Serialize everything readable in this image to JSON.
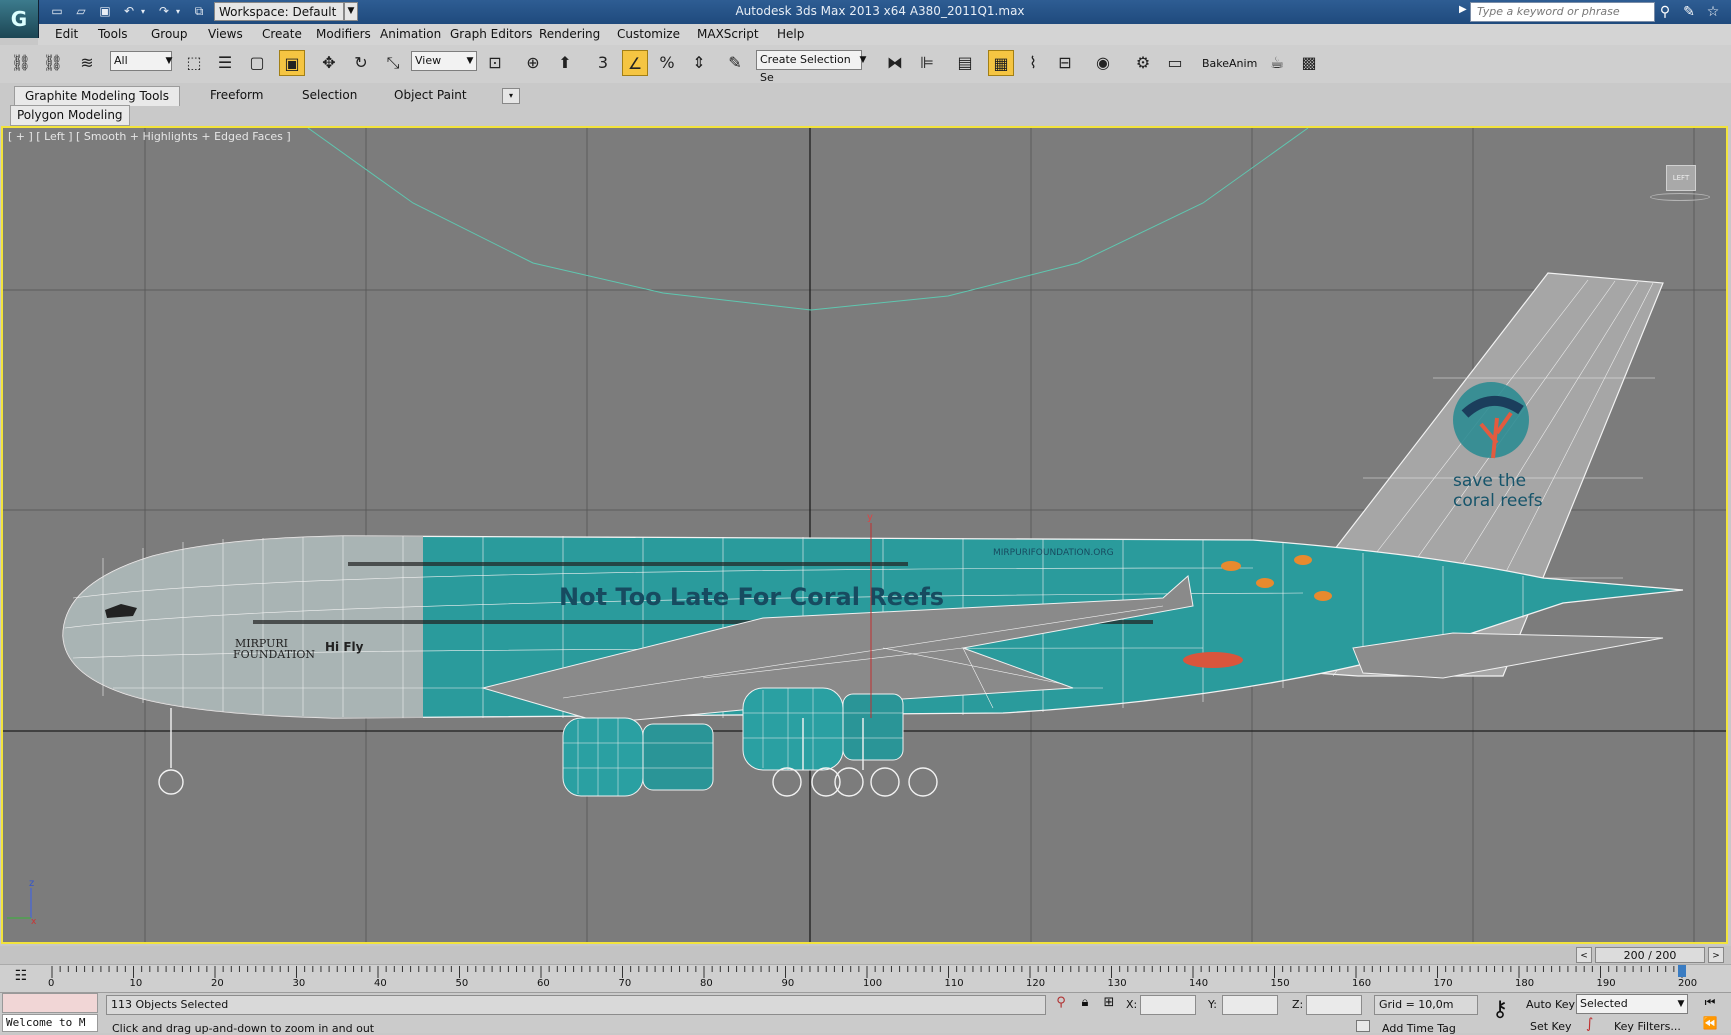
{
  "titlebar": {
    "app_title": "Autodesk 3ds Max  2013 x64     A380_2011Q1.max",
    "workspace": "Workspace: Default",
    "search_placeholder": "Type a keyword or phrase"
  },
  "menu": [
    "Edit",
    "Tools",
    "Group",
    "Views",
    "Create",
    "Modifiers",
    "Animation",
    "Graph Editors",
    "Rendering",
    "Customize",
    "MAXScript",
    "Help"
  ],
  "toolbar": {
    "filter_value": "All",
    "refcoord_value": "View",
    "selection_set_placeholder": "Create Selection Se",
    "bakeanim_label": "BakeAnim"
  },
  "ribbon": {
    "tabs": [
      "Graphite Modeling Tools",
      "Freeform",
      "Selection",
      "Object Paint"
    ],
    "panel_label": "Polygon Modeling"
  },
  "viewport": {
    "label": "[ + ] [ Left ] [ Smooth + Highlights + Edged Faces ]",
    "viewcube_label": "LEFT",
    "livery": {
      "main_text": "Not Too Late For Coral Reefs",
      "url_text": "MIRPURIFOUNDATION.ORG",
      "tail_line1": "save the",
      "tail_line2": "coral reefs",
      "logo_line1": "MIRPURI",
      "logo_line2": "FOUNDATION",
      "airline_text": "Hi Fly"
    },
    "axis_y": "y",
    "axis_z": "z",
    "axis_x": "x"
  },
  "timeline": {
    "frame_display": "200 / 200",
    "ticks": [
      "0",
      "10",
      "20",
      "30",
      "40",
      "50",
      "60",
      "70",
      "80",
      "90",
      "100",
      "110",
      "120",
      "130",
      "140",
      "150",
      "160",
      "170",
      "180",
      "190",
      "200"
    ]
  },
  "status": {
    "welcome": "Welcome to M",
    "objects_selected": "113 Objects Selected",
    "prompt": "Click and drag up-and-down to zoom in and out",
    "x_label": "X:",
    "y_label": "Y:",
    "z_label": "Z:",
    "grid": "Grid = 10,0m",
    "add_time_tag": "Add Time Tag",
    "auto_key": "Auto Key",
    "set_key": "Set Key",
    "key_mode": "Selected",
    "key_filters": "Key Filters..."
  }
}
